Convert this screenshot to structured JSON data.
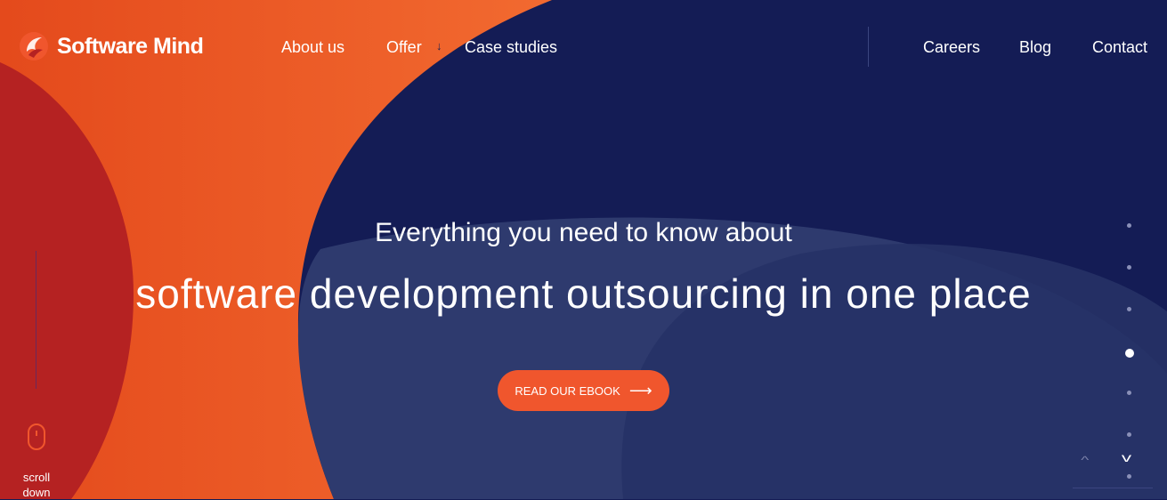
{
  "brand": {
    "name": "Software Mind",
    "logo_icon": "flame-logo-icon"
  },
  "nav": {
    "about": "About us",
    "offer": "Offer",
    "offer_arrow": "↓",
    "case_studies": "Case studies",
    "careers": "Careers",
    "blog": "Blog",
    "contact": "Contact"
  },
  "hero": {
    "subtitle": "Everything you need to know about",
    "title": "software development outsourcing in one place",
    "cta_label": "READ OUR EBOOK",
    "cta_arrow": "⟶"
  },
  "scroll": {
    "line1": "scroll",
    "line2": "down",
    "icon": "mouse-icon"
  },
  "slider": {
    "count": 7,
    "active_index": 3
  },
  "colors": {
    "accent": "#f0562d",
    "navy": "#141c55",
    "red": "#b52222"
  }
}
